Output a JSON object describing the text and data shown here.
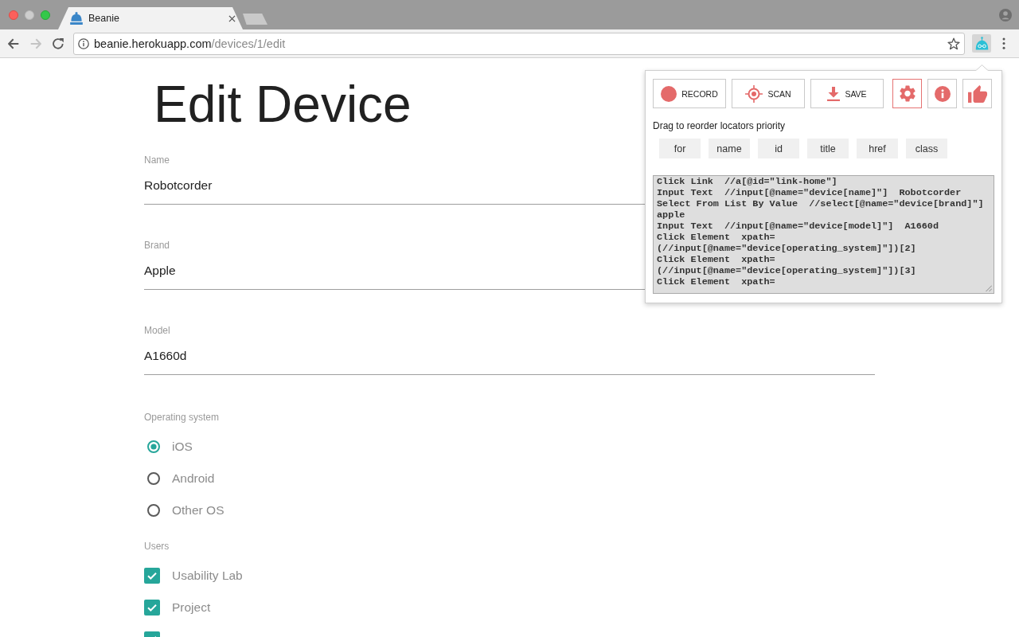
{
  "browser": {
    "tab": {
      "title": "Beanie"
    },
    "nav": [
      {
        "kind": "back",
        "disabled": false
      },
      {
        "kind": "forward",
        "disabled": true
      },
      {
        "kind": "reload",
        "disabled": false
      }
    ],
    "address": {
      "host": "beanie.herokuapp.com",
      "path": "/devices/1/edit"
    },
    "extension": {
      "selected": true
    }
  },
  "page": {
    "title": "Edit Device",
    "fields": [
      {
        "label": "Name",
        "value": "Robotcorder"
      },
      {
        "label": "Brand",
        "value": "Apple"
      },
      {
        "label": "Model",
        "value": "A1660d"
      }
    ],
    "os": {
      "label": "Operating system",
      "options": [
        {
          "label": "iOS",
          "selected": true
        },
        {
          "label": "Android",
          "selected": false
        },
        {
          "label": "Other OS",
          "selected": false
        }
      ]
    },
    "users": {
      "label": "Users",
      "options": [
        {
          "label": "Usability Lab",
          "checked": true
        },
        {
          "label": "Project",
          "checked": true
        },
        {
          "checked": true
        }
      ]
    }
  },
  "popup": {
    "actions": [
      {
        "kind": "record",
        "label": "RECORD",
        "selected": false
      },
      {
        "kind": "scan",
        "label": "SCAN",
        "selected": false
      },
      {
        "kind": "save",
        "label": "SAVE",
        "selected": false
      },
      {
        "kind": "settings",
        "selected": true
      },
      {
        "kind": "info",
        "selected": false
      },
      {
        "kind": "like",
        "selected": false
      }
    ],
    "hint": "Drag to reorder locators priority",
    "locators": [
      "for",
      "name",
      "id",
      "title",
      "href",
      "class"
    ],
    "script": {
      "lines": [
        "Click Link  //a[@id=\"link-home\"]",
        "Input Text  //input[@name=\"device[name]\"]  Robotcorder",
        "Select From List By Value  //select[@name=\"device[brand]\"]",
        "apple",
        "Input Text  //input[@name=\"device[model]\"]  A1660d",
        "Click Element  xpath=",
        "(//input[@name=\"device[operating_system]\"])[2]",
        "Click Element  xpath=",
        "(//input[@name=\"device[operating_system]\"])[3]",
        "Click Element  xpath="
      ]
    }
  }
}
